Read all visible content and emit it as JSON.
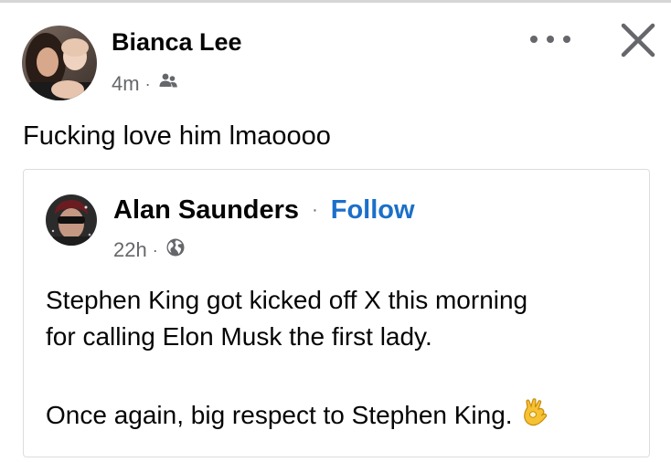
{
  "post": {
    "author": "Bianca Lee",
    "time": "4m",
    "separator": "·",
    "audience_icon": "friends-icon",
    "text": "Fucking love him lmaoooo",
    "menu_icon": "more-options-icon",
    "close_icon": "close-icon"
  },
  "shared_post": {
    "author": "Alan Saunders",
    "separator": "·",
    "follow_label": "Follow",
    "time": "22h",
    "audience_icon": "globe-icon",
    "line_1": "Stephen King got kicked off X this morning",
    "line_2": "for calling Elon Musk the first lady.",
    "line_3": "Once again, big respect to Stephen King.",
    "emoji": "ok-hand-emoji"
  },
  "colors": {
    "follow": "#1b6fc9",
    "secondary_text": "#65676b",
    "primary_text": "#050505",
    "card_border": "#dadde1"
  }
}
